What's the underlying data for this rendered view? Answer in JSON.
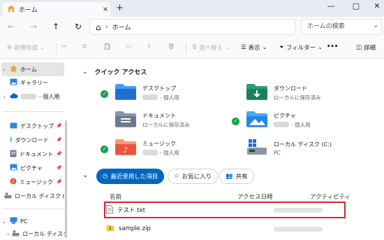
{
  "window": {
    "tab_label": "ホーム",
    "tab_close": "×",
    "new_tab": "+",
    "minimize": "—",
    "maximize": "□",
    "close": "✕"
  },
  "nav": {
    "back": "←",
    "forward": "→",
    "up": "↑",
    "refresh": "↻",
    "home_icon": "⌂",
    "breadcrumb_sep": "›",
    "location": "ホーム",
    "search_placeholder": "ホームの検索"
  },
  "commands": {
    "new": "新規作成",
    "cut": "✂",
    "copy": "⧉",
    "paste": "📋",
    "rename": "▭",
    "share": "⇪",
    "delete": "🗑",
    "sort": "並べ替え",
    "view": "表示",
    "filter": "フィルター",
    "more": "•••",
    "details": "詳細"
  },
  "sidebar": {
    "home": "ホーム",
    "gallery": "ギャラリー",
    "personal_suffix": "- 個人用",
    "desktop": "デスクトップ",
    "downloads": "ダウンロード",
    "documents": "ドキュメント",
    "pictures": "ピクチャ",
    "music": "ミュージック",
    "local_disk_short": "ローカル ディスク (",
    "pc": "PC",
    "local_disk_sub": "ローカル ディスク"
  },
  "quick_access": {
    "title": "クイック アクセス",
    "items": [
      {
        "name": "デスクトップ",
        "sub": "- 個人用"
      },
      {
        "name": "ダウンロード",
        "sub": "ローカルに保存済み"
      },
      {
        "name": "ドキュメント",
        "sub": "ローカルに保存済み"
      },
      {
        "name": "ピクチャ",
        "sub": "- 個人用"
      },
      {
        "name": "ミュージック",
        "sub": "- 個人用"
      },
      {
        "name": "ローカル ディスク (C:)",
        "sub": "PC"
      }
    ]
  },
  "filters": {
    "recent": "最近使用した項目",
    "favorites": "お気に入り",
    "shared": "共有"
  },
  "file_list": {
    "col_name": "名前",
    "col_accessed": "アクセス日時",
    "col_activity": "アクティビティ",
    "files": [
      {
        "name": "テスト.txt"
      },
      {
        "name": "sample.zip"
      }
    ]
  },
  "colors": {
    "accent": "#0067c0",
    "highlight_box": "#d9232e",
    "sync_check": "#16a34a",
    "folder_blue": "#3b8ee8",
    "download_green": "#1a7f5a"
  }
}
